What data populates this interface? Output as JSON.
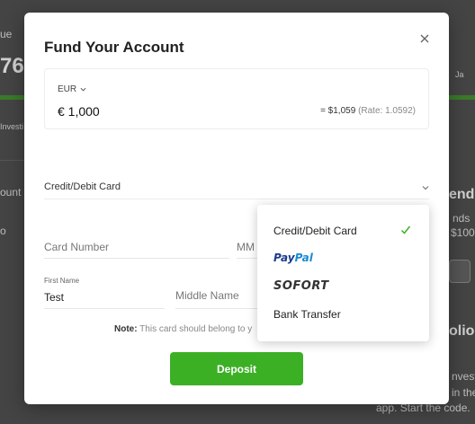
{
  "background": {
    "fragments": [
      "ue",
      "76.",
      "Investi",
      "ount",
      "o",
      "Ja",
      "end",
      "nds",
      "$100",
      "olio",
      "nvestm",
      "in the",
      "app. Start the code."
    ],
    "accent_green": "#3cb025"
  },
  "modal": {
    "title": "Fund Your Account",
    "close_icon": "close-icon",
    "amount": {
      "currency": "EUR",
      "value": "€ 1,000",
      "converted": "= $1,059",
      "rate": "(Rate: 1.0592)"
    },
    "payment_method": {
      "selected": "Credit/Debit Card"
    },
    "fields": {
      "card_number_placeholder": "Card Number",
      "expiry_placeholder": "MM",
      "first_name_label": "First Name",
      "first_name_value": "Test",
      "middle_name_placeholder": "Middle Name"
    },
    "note": {
      "label": "Note:",
      "text": "This card should belong to y"
    },
    "deposit_label": "Deposit",
    "dropdown": {
      "options": [
        {
          "label": "Credit/Debit Card",
          "selected": true
        },
        {
          "label_a": "Pay",
          "label_b": "Pal"
        },
        {
          "label": "SOFORT"
        },
        {
          "label": "Bank Transfer"
        }
      ],
      "check_icon": "check-icon"
    }
  }
}
